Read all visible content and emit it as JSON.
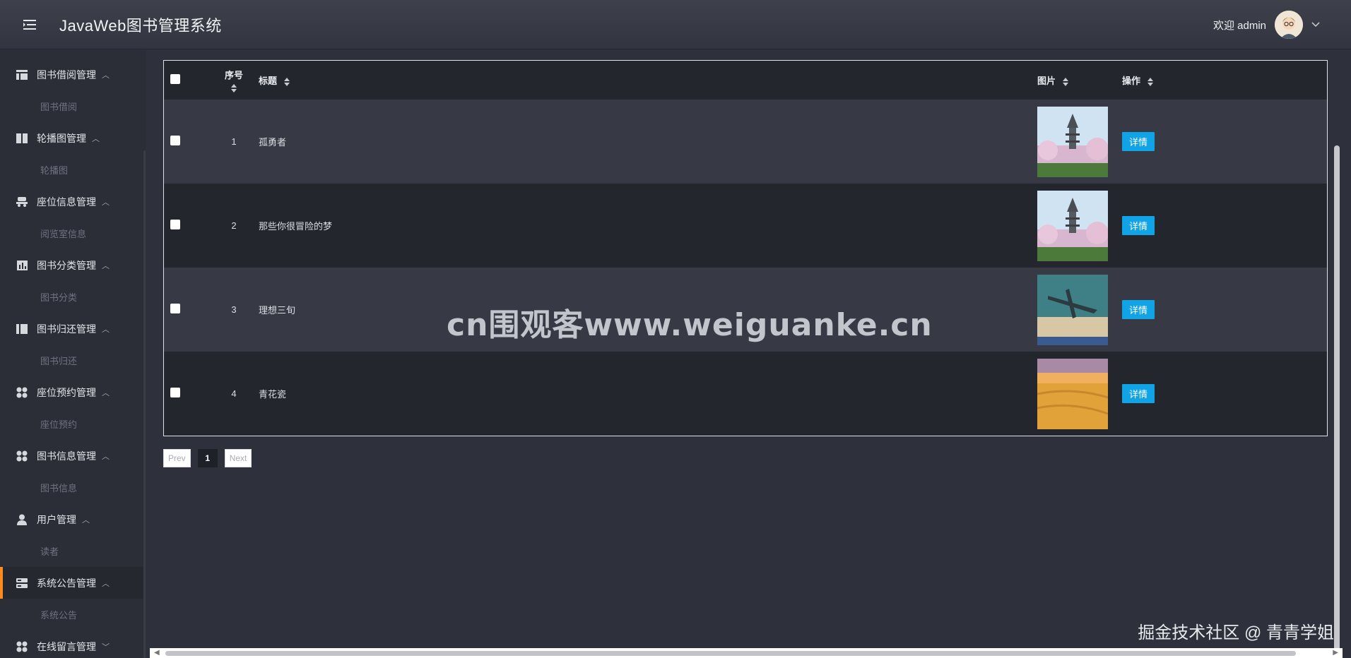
{
  "header": {
    "title": "JavaWeb图书管理系统",
    "welcome": "欢迎 admin"
  },
  "sidebar": {
    "groups": [
      {
        "label": "图书借阅管理",
        "sub": "图书借阅",
        "icon": "table-icon"
      },
      {
        "label": "轮播图管理",
        "sub": "轮播图",
        "icon": "columns-icon"
      },
      {
        "label": "座位信息管理",
        "sub": "阅览室信息",
        "icon": "seat-icon"
      },
      {
        "label": "图书分类管理",
        "sub": "图书分类",
        "icon": "chart-icon"
      },
      {
        "label": "图书归还管理",
        "sub": "图书归还",
        "icon": "columns-icon"
      },
      {
        "label": "座位预约管理",
        "sub": "座位预约",
        "icon": "grid-icon"
      },
      {
        "label": "图书信息管理",
        "sub": "图书信息",
        "icon": "grid-icon"
      },
      {
        "label": "用户管理",
        "sub": "读者",
        "icon": "user-icon"
      },
      {
        "label": "系统公告管理",
        "sub": "系统公告",
        "icon": "server-icon"
      },
      {
        "label": "在线留言管理",
        "sub": "",
        "icon": "grid-icon"
      }
    ]
  },
  "table": {
    "columns": [
      "序号",
      "标题",
      "图片",
      "操作"
    ],
    "rows": [
      {
        "index": "1",
        "title": "孤勇者",
        "image": "pagoda-blossom",
        "action": "详情"
      },
      {
        "index": "2",
        "title": "那些你很冒险的梦",
        "image": "pagoda-blossom",
        "action": "详情"
      },
      {
        "index": "3",
        "title": "理想三旬",
        "image": "plane-beach",
        "action": "详情"
      },
      {
        "index": "4",
        "title": "青花瓷",
        "image": "wheat-field",
        "action": "详情"
      }
    ]
  },
  "pager": {
    "prev": "Prev",
    "page": "1",
    "next": "Next"
  },
  "overlay": {
    "watermark": "cn围观客www.weiguanke.cn",
    "credit": "掘金技术社区 @ 青青学姐"
  },
  "colors": {
    "accent": "#ff8a1e",
    "button": "#10a3e6",
    "header_bg": "#3a3d47",
    "sidebar_bg": "#2b2e37"
  }
}
